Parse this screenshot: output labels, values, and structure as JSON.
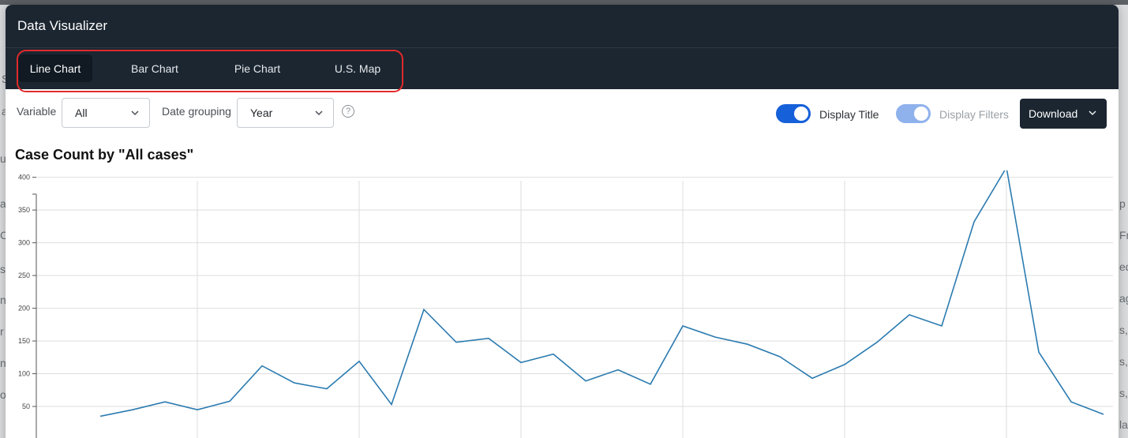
{
  "modal": {
    "title": "Data Visualizer"
  },
  "tabs": [
    {
      "label": "Line Chart",
      "active": true
    },
    {
      "label": "Bar Chart",
      "active": false
    },
    {
      "label": "Pie Chart",
      "active": false
    },
    {
      "label": "U.S. Map",
      "active": false
    }
  ],
  "controls": {
    "variable_label": "Variable",
    "variable_value": "All",
    "date_grouping_label": "Date grouping",
    "date_grouping_value": "Year",
    "help_glyph": "?",
    "display_title_label": "Display Title",
    "display_title_on": true,
    "display_filters_label": "Display Filters",
    "display_filters_on": true,
    "display_filters_disabled": true,
    "download_label": "Download"
  },
  "background_fragments": [
    "S,",
    "a",
    "ul",
    "ac",
    "C",
    "s",
    "n",
    "r",
    "n",
    "o",
    "p",
    "Fr",
    "ed",
    "ag",
    "s,",
    "s,",
    "s,",
    "la"
  ],
  "colors": {
    "header_bg": "#1b2631",
    "toggle_on": "#1660d9",
    "line": "#2b7bb0",
    "highlight": "#e02a2a"
  },
  "chart_data": {
    "type": "line",
    "title": "Case Count by \"All cases\"",
    "y_ticks": [
      50,
      100,
      150,
      200,
      250,
      300,
      350,
      400
    ],
    "ylim": [
      30,
      420
    ],
    "grid": true,
    "series": [
      {
        "values": [
          35,
          45,
          57,
          45,
          58,
          112,
          86,
          77,
          119,
          53,
          198,
          148,
          154,
          117,
          130,
          89,
          106,
          84,
          173,
          156,
          145,
          126,
          93,
          114,
          148,
          190,
          173,
          332,
          415,
          133,
          57,
          38
        ]
      }
    ]
  }
}
